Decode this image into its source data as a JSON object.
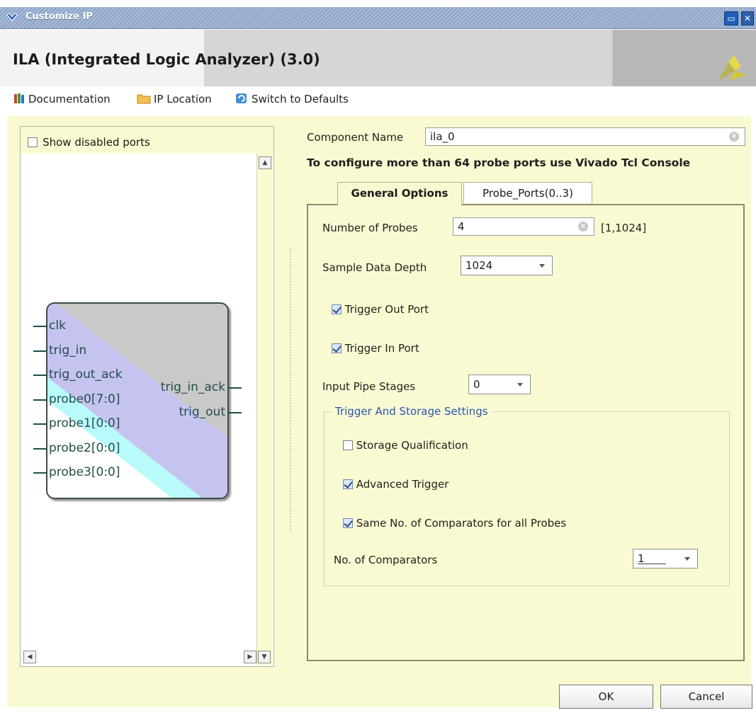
{
  "window": {
    "title": "Customize IP",
    "restore_icon": "restore-icon",
    "close_icon": "close-icon"
  },
  "header": {
    "ip_title": "ILA (Integrated Logic Analyzer) (3.0)"
  },
  "toolbar": {
    "documentation": "Documentation",
    "ip_location": "IP Location",
    "switch_defaults": "Switch to Defaults"
  },
  "left_panel": {
    "show_disabled_label": "Show disabled ports",
    "show_disabled_checked": false,
    "inputs": [
      "clk",
      "trig_in",
      "trig_out_ack",
      "probe0[7:0]",
      "probe1[0:0]",
      "probe2[0:0]",
      "probe3[0:0]"
    ],
    "outputs": [
      "trig_in_ack",
      "trig_out"
    ]
  },
  "component": {
    "label": "Component Name",
    "value": "ila_0"
  },
  "notice": "To configure more than 64 probe ports use Vivado Tcl Console",
  "tabs": [
    {
      "label": "General Options",
      "active": true
    },
    {
      "label": "Probe_Ports(0..3)",
      "active": false
    }
  ],
  "general": {
    "num_probes_label": "Number of Probes",
    "num_probes_value": "4",
    "num_probes_range": "[1,1024]",
    "depth_label": "Sample Data Depth",
    "depth_value": "1024",
    "trigger_out_label": "Trigger Out Port",
    "trigger_out_checked": true,
    "trigger_in_label": "Trigger In Port",
    "trigger_in_checked": true,
    "pipe_label": "Input Pipe Stages",
    "pipe_value": "0"
  },
  "trigger_storage": {
    "title": "Trigger And Storage Settings",
    "storage_qual_label": "Storage Qualification",
    "storage_qual_checked": false,
    "advanced_trigger_label": "Advanced Trigger",
    "advanced_trigger_checked": true,
    "same_comparators_label": "Same No. of Comparators for all Probes",
    "same_comparators_checked": true,
    "comparators_label": "No. of Comparators",
    "comparators_value": "1"
  },
  "buttons": {
    "ok": "OK",
    "cancel": "Cancel"
  },
  "colors": {
    "panel_bg": "#fafad2",
    "group_title": "#2b56b3",
    "port_text": "#244c4c"
  }
}
